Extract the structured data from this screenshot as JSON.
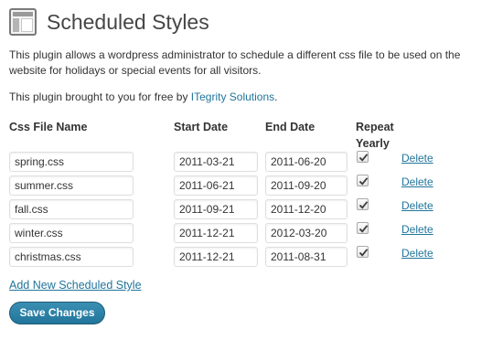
{
  "header": {
    "title": "Scheduled Styles",
    "icon": "settings-page-icon"
  },
  "description": "This plugin allows a wordpress administrator to schedule a different css file to be used on the website for holidays or special events for all visitors.",
  "credit": {
    "prefix": "This plugin brought to you for free by ",
    "link_text": "ITegrity Solutions",
    "suffix": "."
  },
  "table": {
    "headers": {
      "file": "Css File Name",
      "start": "Start Date",
      "end": "End Date",
      "repeat_line1": "Repeat",
      "repeat_line2": "Yearly"
    },
    "rows": [
      {
        "file": "spring.css",
        "start": "2011-03-21",
        "end": "2011-06-20",
        "repeat": true,
        "delete": "Delete"
      },
      {
        "file": "summer.css",
        "start": "2011-06-21",
        "end": "2011-09-20",
        "repeat": true,
        "delete": "Delete"
      },
      {
        "file": "fall.css",
        "start": "2011-09-21",
        "end": "2011-12-20",
        "repeat": true,
        "delete": "Delete"
      },
      {
        "file": "winter.css",
        "start": "2011-12-21",
        "end": "2012-03-20",
        "repeat": true,
        "delete": "Delete"
      },
      {
        "file": "christmas.css",
        "start": "2011-12-21",
        "end": "2011-08-31",
        "repeat": true,
        "delete": "Delete"
      }
    ]
  },
  "add_link": "Add New Scheduled Style",
  "save_button": "Save Changes",
  "colors": {
    "link": "#21759b",
    "button": "#21759b",
    "title": "#464646"
  }
}
